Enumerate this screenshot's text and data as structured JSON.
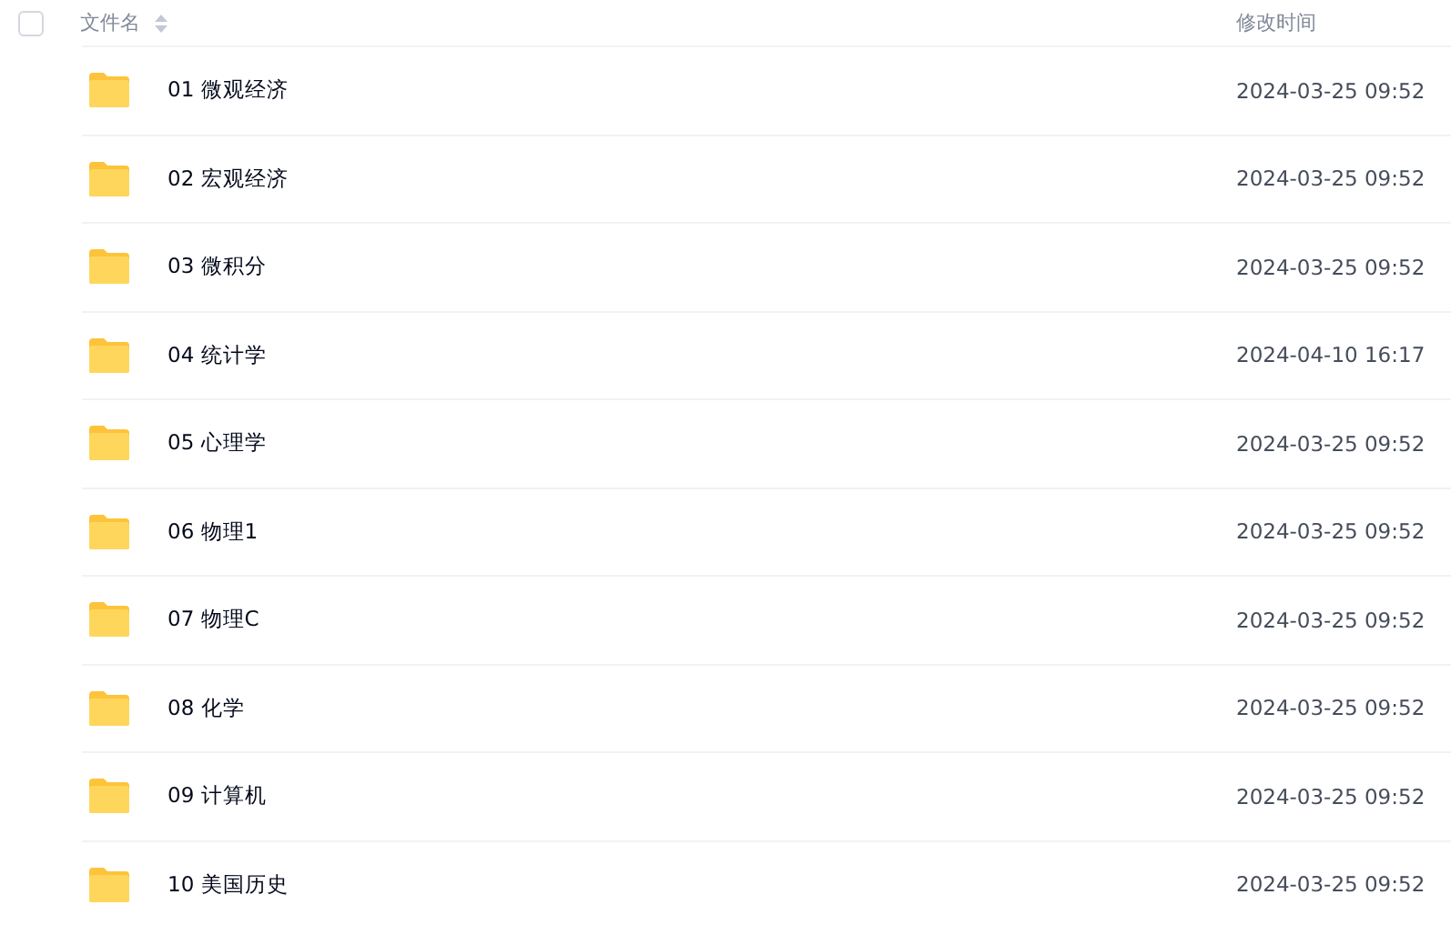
{
  "header": {
    "select_all": {
      "checked": false
    },
    "columns": [
      "文件名",
      "修改时间"
    ]
  },
  "rows": [
    {
      "name": "01 微观经济",
      "modified": "2024-03-25 09:52"
    },
    {
      "name": "02 宏观经济",
      "modified": "2024-03-25 09:52"
    },
    {
      "name": "03 微积分",
      "modified": "2024-03-25 09:52"
    },
    {
      "name": "04 统计学",
      "modified": "2024-04-10 16:17"
    },
    {
      "name": "05 心理学",
      "modified": "2024-03-25 09:52"
    },
    {
      "name": "06 物理1",
      "modified": "2024-03-25 09:52"
    },
    {
      "name": "07 物理C",
      "modified": "2024-03-25 09:52"
    },
    {
      "name": "08 化学",
      "modified": "2024-03-25 09:52"
    },
    {
      "name": "09 计算机",
      "modified": "2024-03-25 09:52"
    },
    {
      "name": "10 美国历史",
      "modified": "2024-03-25 09:52"
    }
  ]
}
